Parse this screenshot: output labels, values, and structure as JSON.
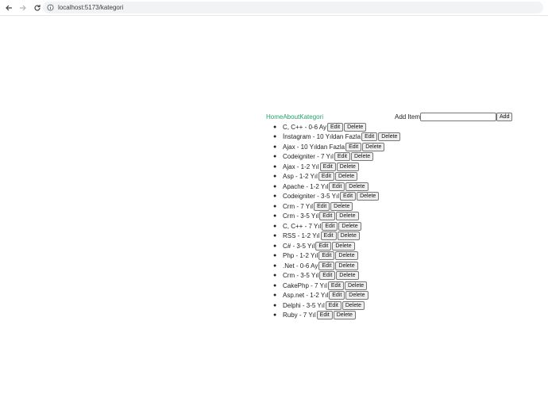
{
  "browser": {
    "url": "localhost:5173/kategori"
  },
  "nav": {
    "links": [
      "Home",
      "About",
      "Kategori"
    ]
  },
  "add": {
    "label": "Add Item",
    "input_value": "",
    "button_label": "Add"
  },
  "buttons": {
    "edit": "Edit",
    "delete": "Delete"
  },
  "items": [
    "C, C++ - 0-6 Ay",
    "İnstagram - 10 Yıldan Fazla",
    "Ajax - 10 Yıldan Fazla",
    "Codeigniter - 7 Yıl",
    "Ajax - 1-2 Yıl",
    "Asp - 1-2 Yıl",
    "Apache - 1-2 Yıl",
    "Codeigniter - 3-5 Yıl",
    "Crm - 7 Yıl",
    "Crm - 3-5 Yıl",
    "C, C++ - 7 Yıl",
    "RSS - 1-2 Yıl",
    "C# - 3-5 Yıl",
    "Php - 1-2 Yıl",
    ".Net - 0-6 Ay",
    "Crm - 3-5 Yıl",
    "CakePhp - 7 Yıl",
    "Asp.net - 1-2 Yıl",
    "Delphi - 3-5 Yıl",
    "Ruby - 7 Yıl"
  ]
}
